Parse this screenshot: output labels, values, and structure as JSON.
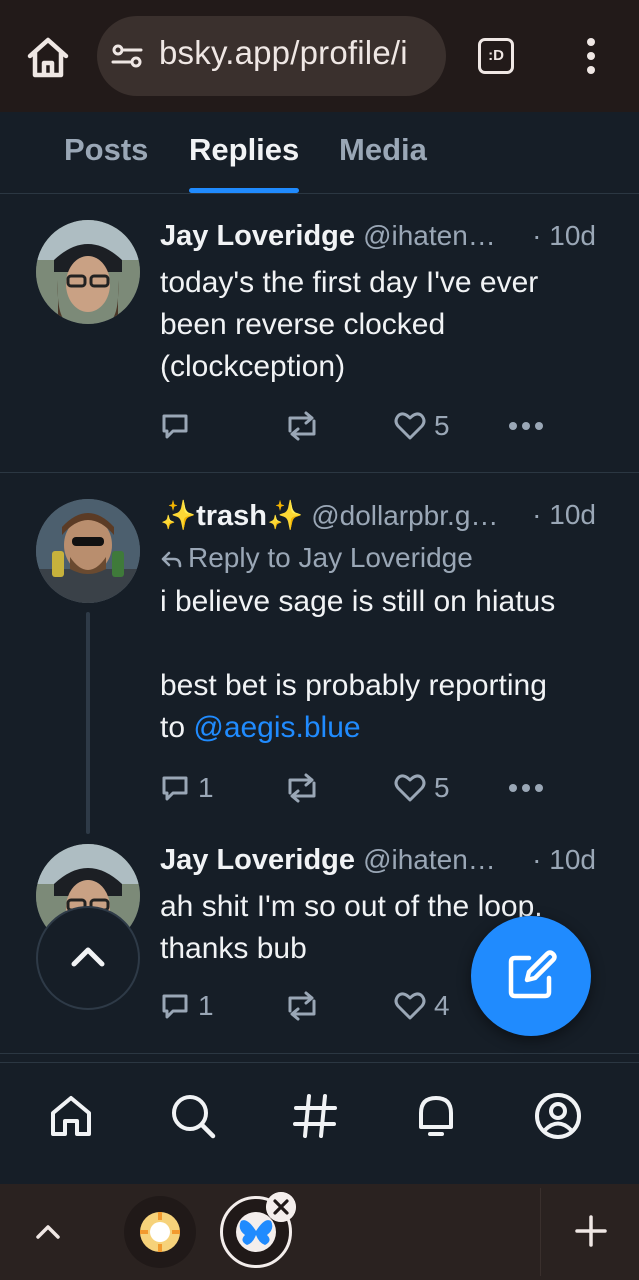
{
  "browser": {
    "url": "bsky.app/profile/i",
    "extension_label": ":D",
    "icons": [
      "home-icon",
      "site-settings-icon",
      "extension-icon",
      "more-vertical-icon"
    ]
  },
  "tabs": [
    {
      "label": "Posts",
      "active": false
    },
    {
      "label": "Replies",
      "active": true
    },
    {
      "label": "Media",
      "active": false
    }
  ],
  "posts": [
    {
      "author": "Jay Loveridge",
      "handle": "@ihaten…",
      "age": "· 10d",
      "reply_to": "",
      "text": "today's the first day I've ever\nbeen reverse clocked\n(clockception)",
      "replies": "",
      "reposts": "",
      "likes": "5"
    },
    {
      "author": "✨trash✨",
      "handle": "@dollarpbr.g…",
      "age": "· 10d",
      "reply_to": "Reply to Jay Loveridge",
      "text": "i believe sage is still on hiatus\n\nbest bet is probably reporting\nto ",
      "mention": "@aegis.blue",
      "replies": "1",
      "reposts": "",
      "likes": "5"
    },
    {
      "author": "Jay Loveridge",
      "handle": "@ihaten…",
      "age": "· 10d",
      "reply_to": "",
      "text": "ah shit I'm so out of the loop.\nthanks bub",
      "replies": "1",
      "reposts": "",
      "likes": "4"
    }
  ],
  "bottom_nav": [
    "home-icon",
    "search-icon",
    "feeds-hash-icon",
    "notifications-bell-icon",
    "profile-icon"
  ],
  "colors": {
    "background": "#161e27",
    "accent": "#208bfe",
    "muted_text": "#9aa7b6",
    "browser_bar": "#221a19"
  }
}
